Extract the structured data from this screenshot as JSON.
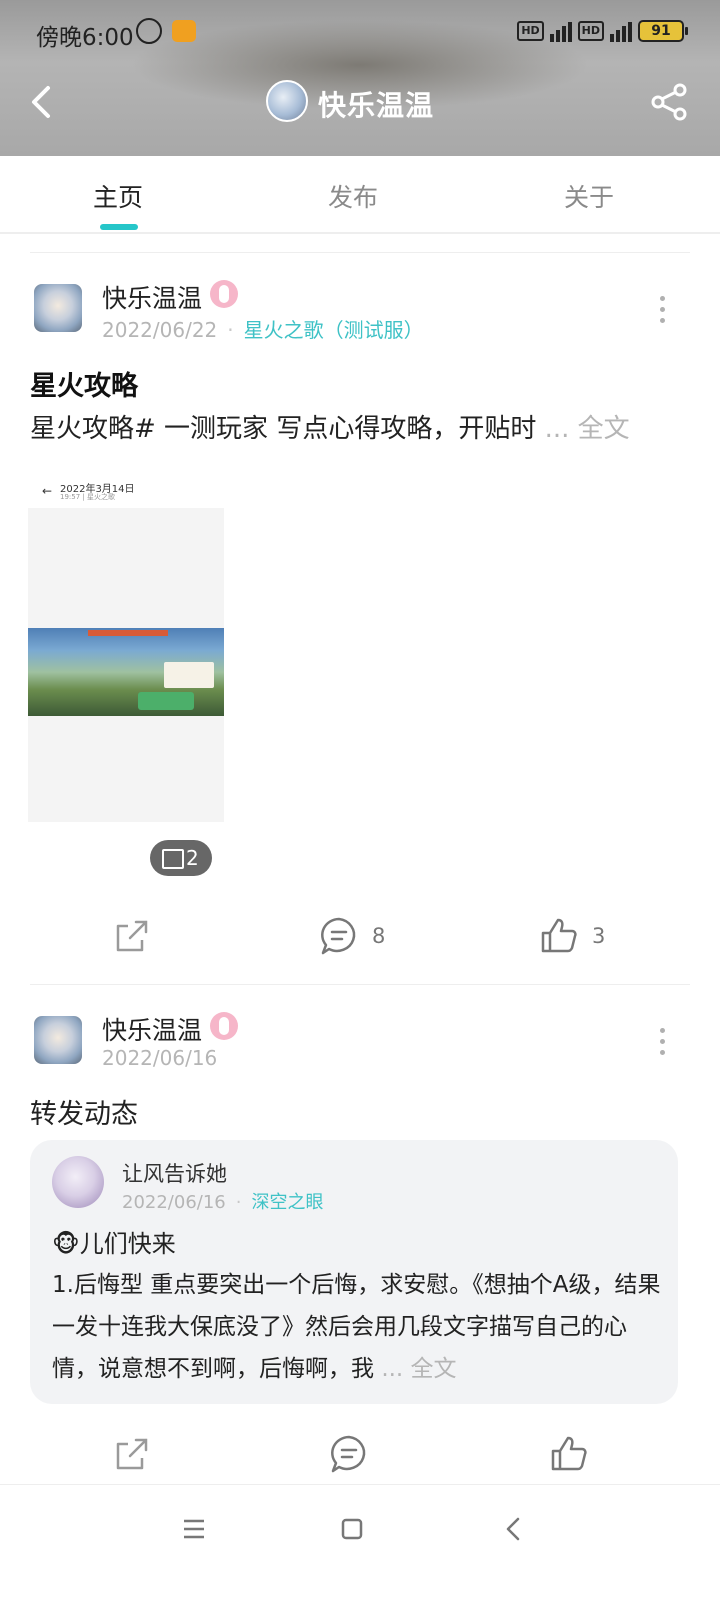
{
  "status_bar": {
    "time": "傍晚6:00",
    "battery": "91",
    "network": "4G",
    "hd": "HD"
  },
  "header": {
    "title": "快乐温温"
  },
  "tabs": [
    {
      "label": "主页",
      "active": true
    },
    {
      "label": "发布",
      "active": false
    },
    {
      "label": "关于",
      "active": false
    }
  ],
  "posts": [
    {
      "author": "快乐温温",
      "date": "2022/06/22",
      "dot": "·",
      "game": "星火之歌（测试服）",
      "title": "星火攻略",
      "text": "星火攻略# 一测玩家 写点心得攻略，开贴时",
      "more_label": "... 全文",
      "image_count": "2",
      "thumb": {
        "date": "2022年3月14日",
        "sub": "19:57 | 星火之歌"
      },
      "comments": "8",
      "likes": "3"
    },
    {
      "author": "快乐温温",
      "date": "2022/06/16",
      "text": "转发动态",
      "quote": {
        "author": "让风告诉她",
        "date": "2022/06/16",
        "dot": "·",
        "game": "深空之眼",
        "headline": "🐵儿们快来",
        "body": "1.后悔型 重点要突出一个后悔，求安慰。《想抽个A级，结果一发十连我大保底没了》然后会用几段文字描写自己的心情，说意想不到啊，后悔啊，我",
        "more_label": "... 全文"
      }
    }
  ],
  "colors": {
    "accent": "#26c6c9",
    "game_link": "#3fc2c6"
  }
}
